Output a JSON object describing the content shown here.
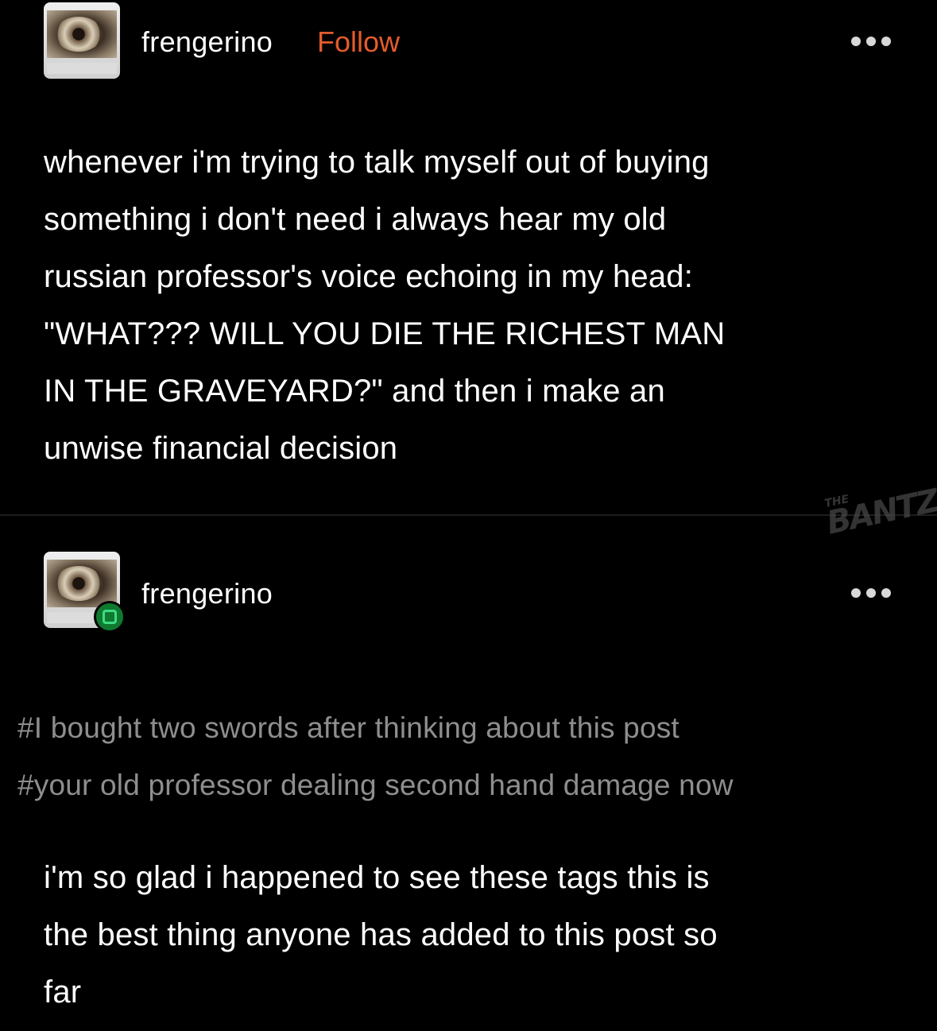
{
  "posts": [
    {
      "username": "frengerino",
      "follow_label": "Follow",
      "body_lines": [
        "whenever i'm trying to talk myself out of buying",
        "something i don't need i always hear my old",
        "russian professor's voice echoing in my head:",
        "\"WHAT??? WILL YOU DIE THE RICHEST MAN",
        "IN THE GRAVEYARD?\" and then i make an",
        "unwise financial decision"
      ]
    },
    {
      "username": "frengerino",
      "tags": [
        "#I bought two swords after thinking about this post",
        "#your old professor dealing second hand damage now"
      ],
      "body_lines": [
        "i'm so glad i happened to see these tags this is",
        "the best thing anyone has added to this post so",
        "far"
      ]
    }
  ],
  "watermark": {
    "small": "THE",
    "large": "BANTZ"
  },
  "icons": {
    "avatar": "eye-artwork-avatar",
    "more": "more-options-icon",
    "reblog": "reblog-icon"
  },
  "colors": {
    "background": "#000000",
    "text": "#ffffff",
    "follow": "#e55b2c",
    "tags": "#8e8e8e",
    "reblog_badge": "#0f7a2f"
  }
}
